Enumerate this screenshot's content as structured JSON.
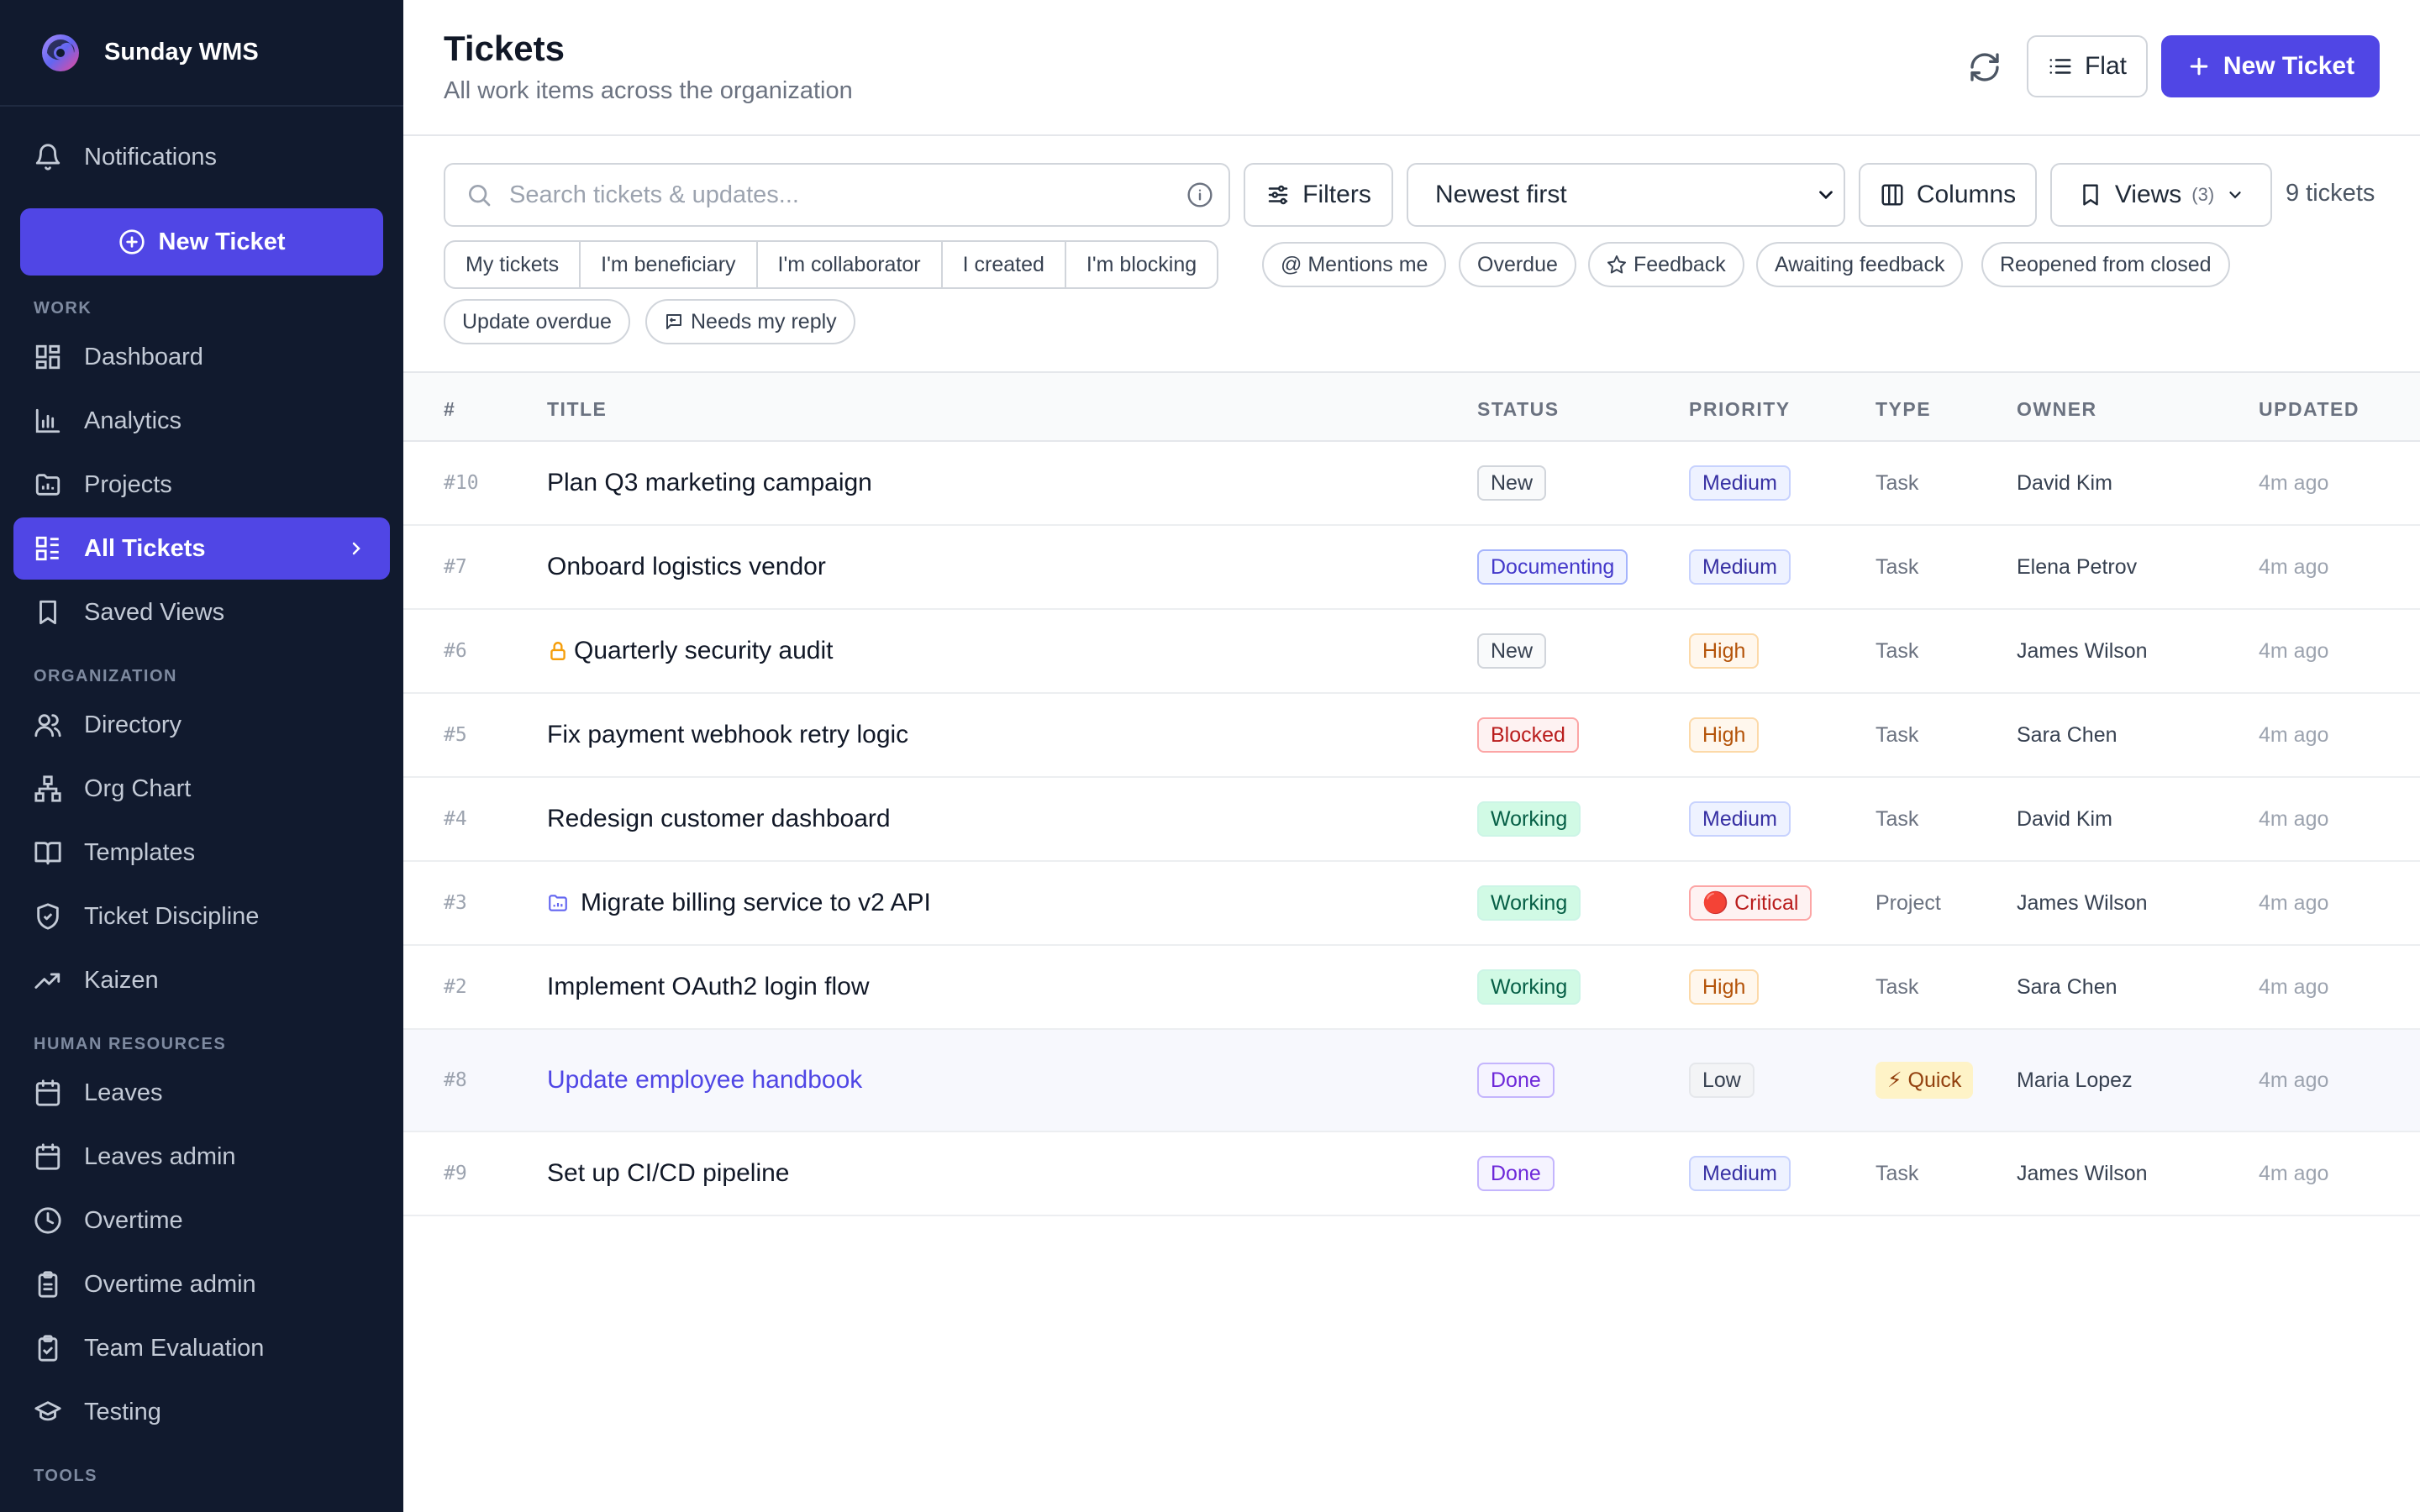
{
  "app": {
    "name": "Sunday WMS"
  },
  "sidebar": {
    "notifications_label": "Notifications",
    "new_ticket_label": "New Ticket",
    "sections": {
      "work": "WORK",
      "organization": "ORGANIZATION",
      "human_resources": "HUMAN RESOURCES",
      "tools": "TOOLS"
    },
    "work_items": [
      {
        "label": "Dashboard",
        "icon": "dashboard-icon"
      },
      {
        "label": "Analytics",
        "icon": "bar-chart-icon"
      },
      {
        "label": "Projects",
        "icon": "folder-chart-icon"
      },
      {
        "label": "All Tickets",
        "icon": "ticket-list-icon",
        "active": true
      },
      {
        "label": "Saved Views",
        "icon": "bookmark-icon"
      }
    ],
    "org_items": [
      {
        "label": "Directory",
        "icon": "users-icon"
      },
      {
        "label": "Org Chart",
        "icon": "org-chart-icon"
      },
      {
        "label": "Templates",
        "icon": "book-icon"
      },
      {
        "label": "Ticket Discipline",
        "icon": "shield-check-icon"
      },
      {
        "label": "Kaizen",
        "icon": "trending-up-icon"
      }
    ],
    "hr_items": [
      {
        "label": "Leaves",
        "icon": "calendar-icon"
      },
      {
        "label": "Leaves admin",
        "icon": "calendar-icon"
      },
      {
        "label": "Overtime",
        "icon": "clock-icon"
      },
      {
        "label": "Overtime admin",
        "icon": "clipboard-icon"
      },
      {
        "label": "Team Evaluation",
        "icon": "clipboard-check-icon"
      },
      {
        "label": "Testing",
        "icon": "graduation-cap-icon"
      }
    ]
  },
  "header": {
    "title": "Tickets",
    "subtitle": "All work items across the organization",
    "flat_label": "Flat",
    "new_ticket_label": "New Ticket"
  },
  "toolbar": {
    "search_placeholder": "Search tickets & updates...",
    "filters_label": "Filters",
    "sort_options": [
      "Newest first"
    ],
    "sort_selected": "Newest first",
    "columns_label": "Columns",
    "views_label": "Views",
    "views_count": "(3)",
    "ticket_count": "9 tickets"
  },
  "quick_filters": {
    "segmented": [
      "My tickets",
      "I'm beneficiary",
      "I'm collaborator",
      "I created",
      "I'm blocking"
    ],
    "mentions": "@ Mentions me",
    "overdue": "Overdue",
    "feedback": "Feedback",
    "awaiting_feedback": "Awaiting feedback",
    "reopened": "Reopened from closed",
    "update_overdue": "Update overdue",
    "needs_reply": "Needs my reply"
  },
  "table": {
    "columns": [
      "#",
      "TITLE",
      "STATUS",
      "PRIORITY",
      "TYPE",
      "OWNER",
      "UPDATED"
    ],
    "rows": [
      {
        "num": "#10",
        "title": "Plan Q3 marketing campaign",
        "status": "New",
        "priority": "Medium",
        "type": "Task",
        "owner": "David Kim",
        "updated": "4m ago"
      },
      {
        "num": "#7",
        "title": "Onboard logistics vendor",
        "status": "Documenting",
        "priority": "Medium",
        "type": "Task",
        "owner": "Elena Petrov",
        "updated": "4m ago"
      },
      {
        "num": "#6",
        "title": "Quarterly security audit",
        "title_icon": "lock-icon",
        "status": "New",
        "priority": "High",
        "type": "Task",
        "owner": "James Wilson",
        "updated": "4m ago"
      },
      {
        "num": "#5",
        "title": "Fix payment webhook retry logic",
        "status": "Blocked",
        "priority": "High",
        "type": "Task",
        "owner": "Sara Chen",
        "updated": "4m ago"
      },
      {
        "num": "#4",
        "title": "Redesign customer dashboard",
        "status": "Working",
        "priority": "Medium",
        "type": "Task",
        "owner": "David Kim",
        "updated": "4m ago"
      },
      {
        "num": "#3",
        "title": "Migrate billing service to v2 API",
        "title_icon": "folder-icon",
        "status": "Working",
        "priority": "🔴 Critical",
        "type": "Project",
        "owner": "James Wilson",
        "updated": "4m ago"
      },
      {
        "num": "#2",
        "title": "Implement OAuth2 login flow",
        "status": "Working",
        "priority": "High",
        "type": "Task",
        "owner": "Sara Chen",
        "updated": "4m ago"
      },
      {
        "num": "#8",
        "title": "Update employee handbook",
        "status": "Done",
        "priority": "Low",
        "type_badge": [
          "⚡",
          "Quick"
        ],
        "owner": "Maria Lopez",
        "updated": "4m ago",
        "highlight": true
      },
      {
        "num": "#9",
        "title": "Set up CI/CD pipeline",
        "status": "Done",
        "priority": "Medium",
        "type": "Task",
        "owner": "James Wilson",
        "updated": "4m ago"
      }
    ]
  },
  "colors": {
    "sidebar_bg": "#111a2e",
    "accent": "#5046e5",
    "status_new": "#374151",
    "status_documenting": "#4338ca",
    "status_blocked": "#b91c1c",
    "status_working": "#065f46",
    "status_done": "#6d28d9",
    "priority_medium": "#3730a3",
    "priority_high": "#b45309",
    "priority_critical": "#b91c1c",
    "priority_low": "#374151"
  }
}
